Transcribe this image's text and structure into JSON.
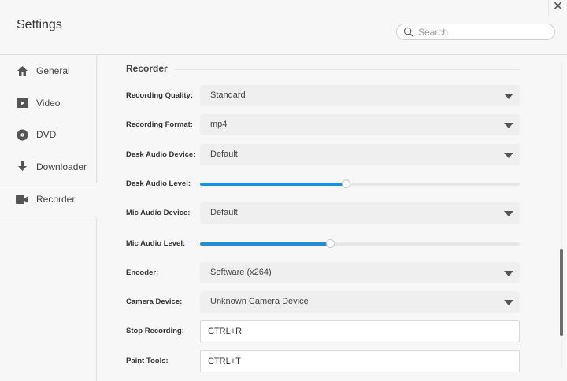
{
  "window": {
    "title": "Settings",
    "close_label": "✕"
  },
  "search": {
    "placeholder": "Search",
    "value": ""
  },
  "sidebar": {
    "items": [
      {
        "label": "General",
        "icon": "home-icon"
      },
      {
        "label": "Video",
        "icon": "video-icon"
      },
      {
        "label": "DVD",
        "icon": "disc-icon"
      },
      {
        "label": "Downloader",
        "icon": "download-icon"
      },
      {
        "label": "Recorder",
        "icon": "camera-icon",
        "active": true
      }
    ]
  },
  "section": {
    "title": "Recorder"
  },
  "fields": {
    "quality": {
      "label": "Recording Quality:",
      "value": "Standard"
    },
    "format": {
      "label": "Recording Format:",
      "value": "mp4"
    },
    "desk_device": {
      "label": "Desk Audio Device:",
      "value": "Default"
    },
    "desk_level": {
      "label": "Desk Audio Level:",
      "percent": 45.5
    },
    "mic_device": {
      "label": "Mic Audio Device:",
      "value": "Default"
    },
    "mic_level": {
      "label": "Mic Audio Level:",
      "percent": 40.6
    },
    "encoder": {
      "label": "Encoder:",
      "value": "Software (x264)"
    },
    "camera": {
      "label": "Camera Device:",
      "value": "Unknown Camera Device"
    },
    "stop": {
      "label": "Stop Recording:",
      "value": "CTRL+R"
    },
    "paint": {
      "label": "Paint Tools:",
      "value": "CTRL+T"
    }
  },
  "colors": {
    "accent": "#1a90e0"
  }
}
